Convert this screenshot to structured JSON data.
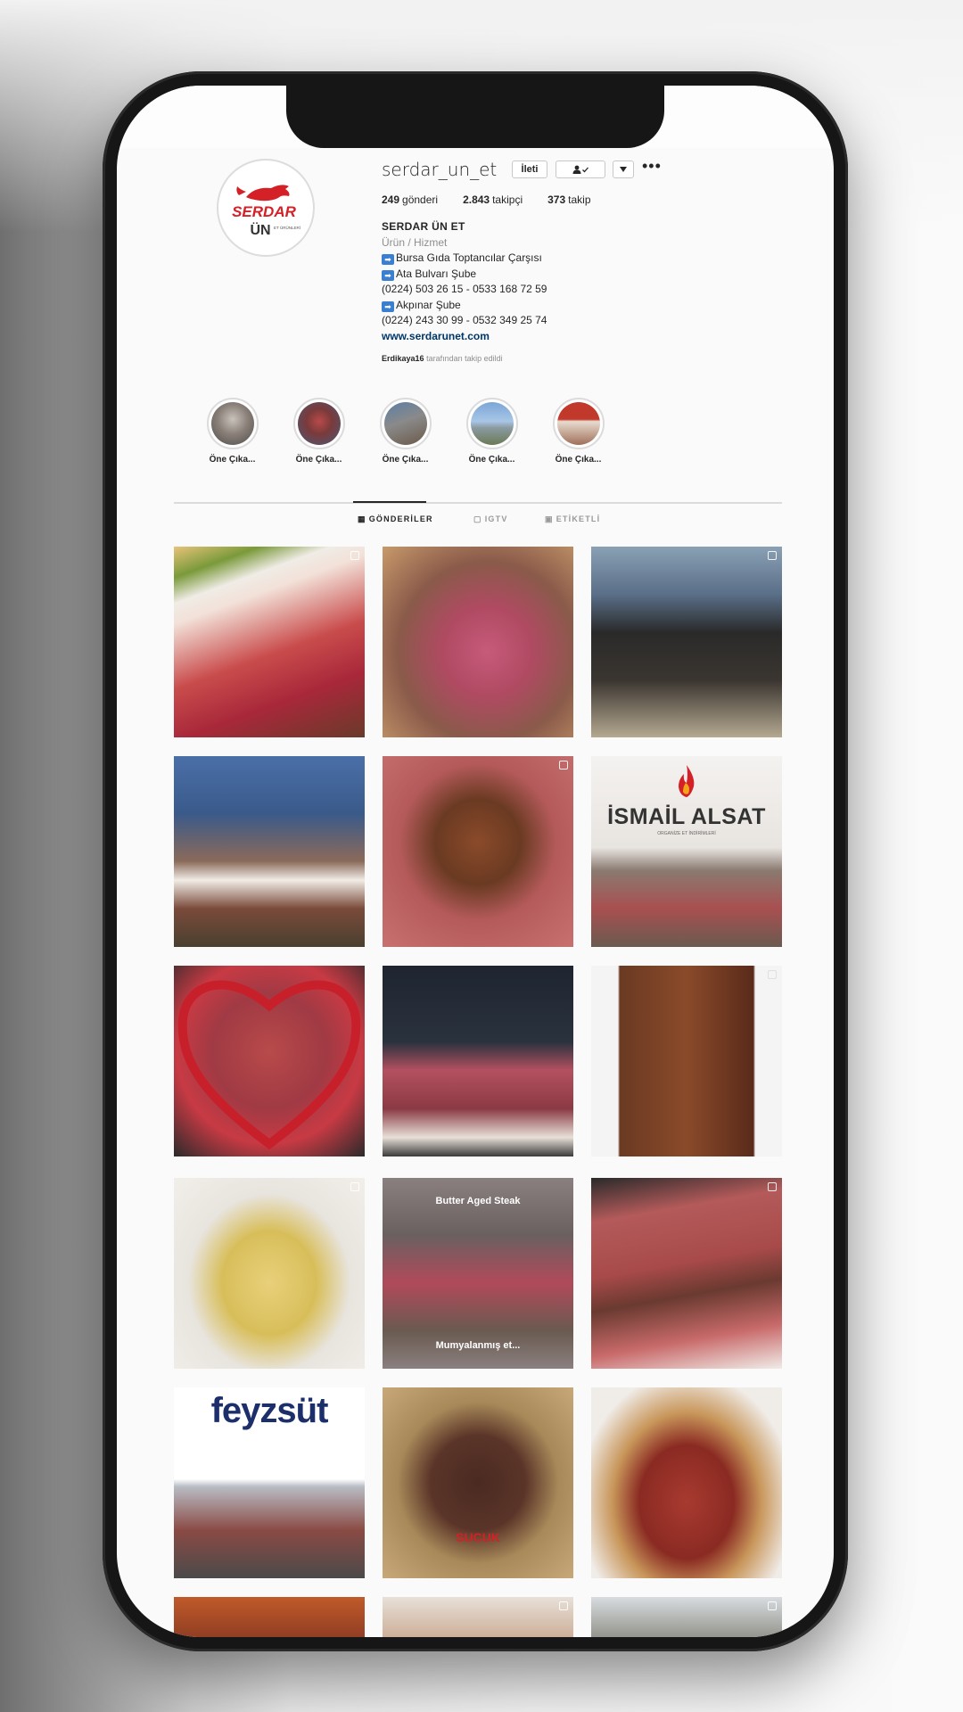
{
  "profile": {
    "username": "serdar_un_et",
    "message_button": "İleti",
    "follow_icon": "person-check-icon",
    "dropdown_icon": "chevron-down-icon",
    "more_icon": "more-horizontal-icon",
    "logo_text_top": "SERDAR",
    "logo_text_bottom": "ÜN",
    "logo_tagline": "ET ÜRÜNLERİ",
    "stats": {
      "posts_count": "249",
      "posts_label": "gönderi",
      "followers_count": "2.843",
      "followers_label": "takipçi",
      "following_count": "373",
      "following_label": "takip"
    },
    "bio": {
      "name": "SERDAR ÜN ET",
      "category": "Ürün / Hizmet",
      "line1": "Bursa Gıda Toptancılar Çarşısı",
      "line2": "Ata Bulvarı Şube",
      "line3": "(0224) 503 26 15 - 0533 168 72 59",
      "line4": "Akpınar Şube",
      "line5": "(0224) 243 30 99 - 0532 349 25 74",
      "website": "www.serdarunet.com",
      "arrow_glyph": "➡"
    },
    "followed_by_user": "Erdikaya16",
    "followed_by_suffix": "tarafından takip edildi"
  },
  "highlights": [
    {
      "label": "Öne Çıka..."
    },
    {
      "label": "Öne Çıka..."
    },
    {
      "label": "Öne Çıka..."
    },
    {
      "label": "Öne Çıka..."
    },
    {
      "label": "Öne Çıka..."
    }
  ],
  "tabs": {
    "posts": "GÖNDERİLER",
    "igtv": "IGTV",
    "tagged": "ETİKETLİ",
    "posts_icon": "▦",
    "igtv_icon": "▢",
    "tagged_icon": "▣"
  },
  "post_texts": {
    "ismail_brand": "İSMAİL ALSAT",
    "ismail_sub": "ORGANİZE ET İNDİRİMLERİ",
    "steak_title": "Butter Aged Steak",
    "steak_caption": "Mumyalanmış et...",
    "feyz_brand": "feyzsüt",
    "sucuk_label": "SUCUK"
  },
  "colors": {
    "brand_red": "#d42027",
    "link_blue": "#00376b",
    "text": "#262626",
    "muted": "#8e8e8e"
  }
}
